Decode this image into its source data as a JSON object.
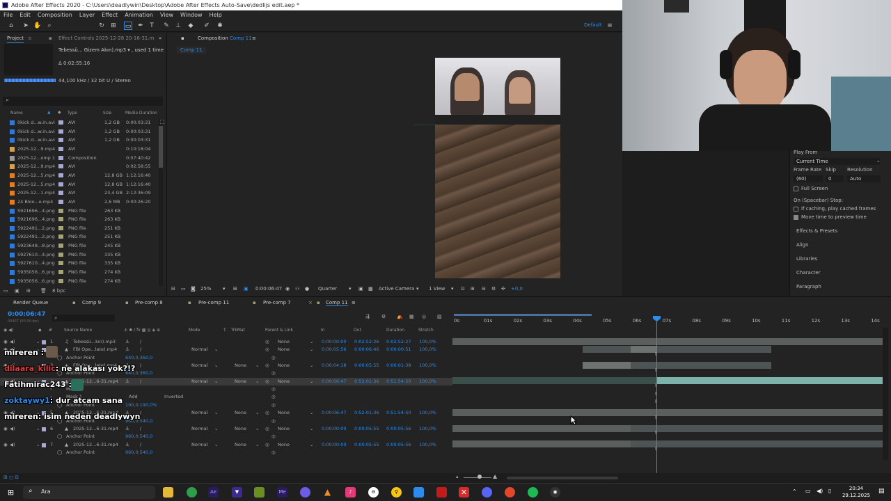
{
  "window_title": "Adobe After Effects 2020 - C:\\Users\\deadlywin\\Desktop\\Adobe After Effects Auto-Save\\dedlijs edit.aep *",
  "menu": [
    "File",
    "Edit",
    "Composition",
    "Layer",
    "Effect",
    "Animation",
    "View",
    "Window",
    "Help"
  ],
  "toolbar": {
    "workspace": "Default"
  },
  "project_panel": {
    "tab_label": "Project",
    "effect_controls_tab": "Effect Controls 2025-12-28 20-16-31.m",
    "selected_item": "Tebessü... Gizem Akın).mp3 ▾ , used 1 time",
    "duration": "Δ 0:02:55:16",
    "audio_info": "44,100 kHz / 32 bit U / Stereo",
    "search_placeholder": "",
    "columns": [
      "Name",
      "Type",
      "Size",
      "Media Duration"
    ],
    "bpc": "8 bpc",
    "items": [
      {
        "name": "0kick d...w.in.avi",
        "type": "AVI",
        "size": "1,2 GB",
        "duration": "0:00:03:31",
        "color": "#2d7ad6"
      },
      {
        "name": "0kick d...w.in.avi",
        "type": "AVI",
        "size": "1,2 GB",
        "duration": "0:00:03:31",
        "color": "#2d7ad6"
      },
      {
        "name": "0kick d...w.in.avi",
        "type": "AVI",
        "size": "1,2 GB",
        "duration": "0:00:03:31",
        "color": "#2d7ad6"
      },
      {
        "name": "2025-12...9.mp4",
        "type": "AVI",
        "size": "",
        "duration": "0:10:18:04",
        "color": "#d4a24a"
      },
      {
        "name": "2025-12...omp 1",
        "type": "Composition",
        "size": "",
        "duration": "0:07:40:42",
        "color": "#9a9a9a"
      },
      {
        "name": "2025-12...9.mp4",
        "type": "AVI",
        "size": "",
        "duration": "0:02:58:55",
        "color": "#d4a24a"
      },
      {
        "name": "2025-12...5.mp4",
        "type": "AVI",
        "size": "12,8 GB",
        "duration": "1:12:16:40",
        "color": "#e07c22"
      },
      {
        "name": "2025-12...5.mp4",
        "type": "AVI",
        "size": "12,8 GB",
        "duration": "1:12:16:40",
        "color": "#e07c22"
      },
      {
        "name": "2025-12...1.mp4",
        "type": "AVI",
        "size": "23,4 GB",
        "duration": "2:12:36:09",
        "color": "#e07c22"
      },
      {
        "name": "24 Bloo...e.mp4",
        "type": "AVI",
        "size": "2,6 MB",
        "duration": "0:00:26:20",
        "color": "#e07c22"
      },
      {
        "name": "5921696...4.png",
        "type": "PNG file",
        "size": "263 KB",
        "duration": "",
        "color": "#2d7ad6"
      },
      {
        "name": "5921696...4.png",
        "type": "PNG file",
        "size": "263 KB",
        "duration": "",
        "color": "#2d7ad6"
      },
      {
        "name": "5922491...2.png",
        "type": "PNG file",
        "size": "251 KB",
        "duration": "",
        "color": "#2d7ad6"
      },
      {
        "name": "5922491...2.png",
        "type": "PNG file",
        "size": "251 KB",
        "duration": "",
        "color": "#2d7ad6"
      },
      {
        "name": "5923648...8.png",
        "type": "PNG file",
        "size": "245 KB",
        "duration": "",
        "color": "#2d7ad6"
      },
      {
        "name": "5927610...4.png",
        "type": "PNG file",
        "size": "335 KB",
        "duration": "",
        "color": "#2d7ad6"
      },
      {
        "name": "5927610...4.png",
        "type": "PNG file",
        "size": "335 KB",
        "duration": "",
        "color": "#2d7ad6"
      },
      {
        "name": "5935056...6.png",
        "type": "PNG file",
        "size": "274 KB",
        "duration": "",
        "color": "#2d7ad6"
      },
      {
        "name": "5935056...6.png",
        "type": "PNG file",
        "size": "274 KB",
        "duration": "",
        "color": "#2d7ad6"
      }
    ]
  },
  "composition_panel": {
    "tab_label": "Composition",
    "comp_name": "Comp 11",
    "breadcrumb": "Comp 11",
    "zoom": "25%",
    "timecode": "0:00:06:47",
    "resolution": "Quarter",
    "camera": "Active Camera",
    "view": "1 View",
    "exposure": "+0,0"
  },
  "preview_panel": {
    "play_from_label": "Play From",
    "play_from_value": "Current Time",
    "frame_rate_label": "Frame Rate",
    "skip_label": "Skip",
    "resolution_label": "Resolution",
    "frame_rate_value": "(60)",
    "skip_value": "0",
    "resolution_value": "Auto",
    "full_screen": "Full Screen",
    "spacebar_stop": "On (Spacebar) Stop:",
    "cache_option": "If caching, play cached frames",
    "move_time_option": "Move time to preview time",
    "sections": [
      "Effects & Presets",
      "Align",
      "Libraries",
      "Character",
      "Paragraph"
    ]
  },
  "timeline": {
    "tabs": [
      "Render Queue",
      "Comp 9",
      "Pre-comp 8",
      "Pre-comp 11",
      "Pre-comp 7",
      "Comp 11"
    ],
    "timecode": "0:00:06:47",
    "fps_label": "00407 (60.00 fps)",
    "headers": [
      "Source Name",
      "Mode",
      "T",
      "TrkMat",
      "Parent & Link",
      "In",
      "Out",
      "Duration",
      "Stretch"
    ],
    "ruler": [
      "0s",
      "01s",
      "02s",
      "03s",
      "04s",
      "05s",
      "06s",
      "07s",
      "08s",
      "09s",
      "10s",
      "11s",
      "12s",
      "13s",
      "14s"
    ],
    "layers": [
      {
        "num": "1",
        "name": "Tebessü...kın).mp3",
        "mode": "",
        "trkmat": "",
        "parent": "None",
        "in": "0:00:00:00",
        "out": "0:02:52:26",
        "dur": "0:02:52:27",
        "stretch": "100,0%"
      },
      {
        "num": "2",
        "name": "FBI Ope...late).mp4",
        "mode": "Normal",
        "trkmat": "",
        "parent": "None",
        "in": "0:00:05:56",
        "out": "0:00:06:46",
        "dur": "0:00:00:51",
        "stretch": "100,0%"
      },
      {
        "sub": "Anchor Point",
        "value": "640,0,360,0"
      },
      {
        "num": "3",
        "name": "FBI Ope...late).mp4",
        "mode": "Normal",
        "trkmat": "None",
        "parent": "None",
        "in": "0:00:04:18",
        "out": "0:00:05:55",
        "dur": "0:00:01:38",
        "stretch": "100,0%"
      },
      {
        "sub": "Anchor Point",
        "value": "640,0,360,0"
      },
      {
        "num": "4",
        "name": "2025-12...6-31.mp4",
        "mode": "Normal",
        "trkmat": "None",
        "parent": "None",
        "in": "0:00:06:47",
        "out": "0:52:01:36",
        "dur": "0:51:54:50",
        "stretch": "100,0%"
      },
      {
        "sub": "Masks"
      },
      {
        "sub": "Mask 1",
        "mask_mode": "Add",
        "inverted": "Inverted"
      },
      {
        "sub": "Anchor Point",
        "value": "190,0,190,0%"
      },
      {
        "num": "5",
        "name": "2025-12...6-31.mp4",
        "mode": "Normal",
        "trkmat": "None",
        "parent": "None",
        "in": "0:00:06:47",
        "out": "0:52:01:36",
        "dur": "0:51:54:50",
        "stretch": "100,0%"
      },
      {
        "sub": "Anchor Point",
        "value": "960,0,540,0"
      },
      {
        "num": "6",
        "name": "2025-12...6-31.mp4",
        "mode": "Normal",
        "trkmat": "None",
        "parent": "None",
        "in": "0:00:00:00",
        "out": "0:00:05:55",
        "dur": "0:00:05:56",
        "stretch": "100,0%"
      },
      {
        "sub": "Anchor Point",
        "value": "960,0,540,0"
      },
      {
        "num": "7",
        "name": "2025-12...6-31.mp4",
        "mode": "Normal",
        "trkmat": "None",
        "parent": "None",
        "in": "0:00:00:00",
        "out": "0:00:05:55",
        "dur": "0:00:05:56",
        "stretch": "100,0%"
      },
      {
        "sub": "Anchor Point",
        "value": "960,0,540,0"
      }
    ]
  },
  "chat": [
    {
      "user": "mireren :",
      "msg": "",
      "color": "#ffffff"
    },
    {
      "user": "dilaara_kilic",
      "msg": ": ne alakası yok?!?",
      "color": "#e03a3a"
    },
    {
      "user": "Fatihmirac243 :",
      "msg": "",
      "color": "#ffffff"
    },
    {
      "user": "zoktaywy1",
      "msg": ": dur atcam sana",
      "color": "#2d8ceb"
    },
    {
      "user": "mireren",
      "msg": ": isim neden deadlywyn",
      "color": "#ffffff"
    }
  ],
  "taskbar": {
    "search_label": "Ara",
    "time": "20:34",
    "date": "29.12.2025"
  }
}
